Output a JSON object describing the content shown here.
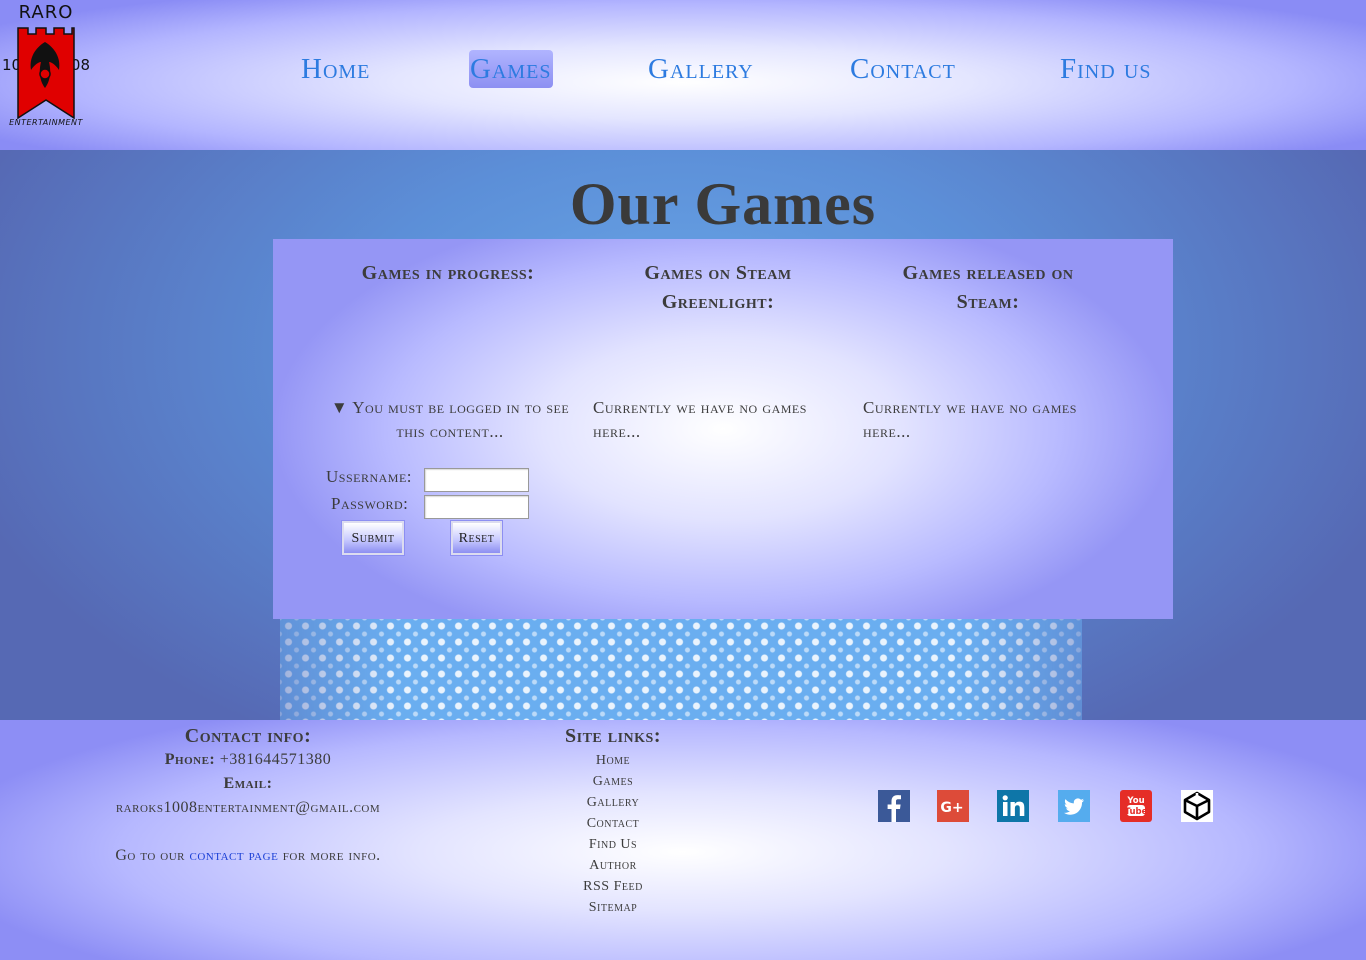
{
  "logo": {
    "top_text": "RARO",
    "left_num": "10",
    "right_num": "08",
    "bottom_text": "ENTERTAINMENT",
    "banner_color": "#e00000"
  },
  "nav": {
    "items": [
      {
        "label": "Home"
      },
      {
        "label": "Games",
        "active": true
      },
      {
        "label": "Gallery"
      },
      {
        "label": "Contact"
      },
      {
        "label": "Find us"
      }
    ],
    "link_color": "#2d7be0"
  },
  "main": {
    "title": "Our Games",
    "columns": [
      {
        "heading": "Games in progress:",
        "body": "▼ You must be logged in to see this content..."
      },
      {
        "heading": "Games on Steam Greenlight:",
        "body": "Currently we have no games here..."
      },
      {
        "heading": "Games released on Steam:",
        "body": "Currently we have no games here..."
      }
    ],
    "login": {
      "username_label": "Ussername:",
      "password_label": "Password:",
      "username_value": "",
      "password_value": "",
      "submit_label": "Submit",
      "reset_label": "Reset"
    }
  },
  "footer": {
    "contact": {
      "heading": "Contact info:",
      "phone_label": "Phone:",
      "phone_value": "+381644571380",
      "email_label": "Email:",
      "email_value": "raroks1008entertainment@gmail.com",
      "goto_prefix": "Go to our",
      "goto_link": "contact page",
      "goto_suffix": "for more info."
    },
    "site_links": {
      "heading": "Site links:",
      "items": [
        "Home",
        "Games",
        "Gallery",
        "Contact",
        "Find Us",
        "Author",
        "RSS Feed",
        "Sitemap"
      ]
    },
    "social": [
      {
        "icon": "facebook-icon",
        "glyph": "f",
        "color": "#3b5998"
      },
      {
        "icon": "google-plus-icon",
        "glyph": "G+",
        "color": "#dd4b39"
      },
      {
        "icon": "linkedin-icon",
        "glyph": "in",
        "color": "#0e76a8"
      },
      {
        "icon": "twitter-icon",
        "glyph": "",
        "color": "#55acee"
      },
      {
        "icon": "youtube-icon",
        "glyph": "You Tube",
        "color": "#e52d27"
      },
      {
        "icon": "unity-icon",
        "glyph": "",
        "color": "#000000"
      }
    ]
  }
}
